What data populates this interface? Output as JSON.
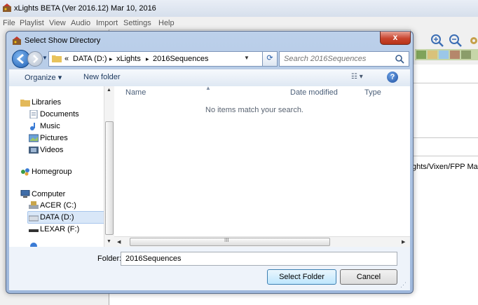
{
  "app": {
    "title": "xLights BETA (Ver 2016.12) Mar 10, 2016",
    "menu": [
      "File",
      "Playlist",
      "View",
      "Audio",
      "Import",
      "Settings",
      "Help"
    ],
    "background_path_fragment": "ghts/Vixen/FPP Map"
  },
  "dialog": {
    "title": "Select Show Directory",
    "close_label": "x",
    "address": {
      "overflow": "«",
      "crumbs": [
        "DATA (D:)",
        "xLights",
        "2016Sequences"
      ],
      "separator": "▸"
    },
    "search_placeholder": "Search 2016Sequences",
    "toolbar": {
      "organize_label": "Organize ▾",
      "new_folder_label": "New folder"
    },
    "nav": {
      "items": [
        {
          "label": "Libraries",
          "icon": "library-icon",
          "color": "#e3b95a"
        },
        {
          "label": "Documents",
          "icon": "documents-icon",
          "color": "#d9e3ef"
        },
        {
          "label": "Music",
          "icon": "music-icon",
          "color": "#3a7bd5"
        },
        {
          "label": "Pictures",
          "icon": "pictures-icon",
          "color": "#6aa0d8"
        },
        {
          "label": "Videos",
          "icon": "videos-icon",
          "color": "#45607f"
        },
        {
          "label": "Homegroup",
          "icon": "homegroup-icon",
          "color": "#3a9a46"
        },
        {
          "label": "Computer",
          "icon": "computer-icon",
          "color": "#3f6da8"
        },
        {
          "label": "ACER (C:)",
          "icon": "drive-icon",
          "color": "#c9a64c"
        },
        {
          "label": "DATA (D:)",
          "icon": "drive-icon",
          "color": "#9aa4b0"
        },
        {
          "label": "LEXAR (F:)",
          "icon": "usb-drive-icon",
          "color": "#333333"
        }
      ],
      "selected": "DATA (D:)"
    },
    "columns": [
      "Name",
      "Date modified",
      "Type"
    ],
    "empty_message": "No items match your search.",
    "h_scroll_grip": "III",
    "folder_label": "Folder:",
    "folder_value": "2016Sequences",
    "select_button": "Select Folder",
    "cancel_button": "Cancel"
  },
  "colors": {
    "accent": "#1d4f9e",
    "selection": "#d9e7f8"
  }
}
